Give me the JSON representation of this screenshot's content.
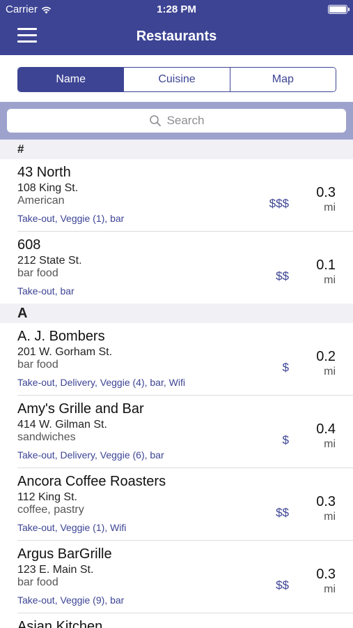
{
  "status_bar": {
    "carrier": "Carrier",
    "time": "1:28 PM"
  },
  "nav": {
    "title": "Restaurants"
  },
  "segments": [
    {
      "label": "Name",
      "active": true
    },
    {
      "label": "Cuisine",
      "active": false
    },
    {
      "label": "Map",
      "active": false
    }
  ],
  "search": {
    "placeholder": "Search"
  },
  "sections": [
    {
      "header": "#",
      "items": [
        {
          "name": "43 North",
          "address": "108 King St.",
          "cuisine": "American",
          "tags": "Take-out, Veggie (1), bar",
          "price": "$$$",
          "distance": "0.3",
          "unit": "mi"
        },
        {
          "name": "608",
          "address": "212 State St.",
          "cuisine": "bar food",
          "tags": "Take-out, bar",
          "price": "$$",
          "distance": "0.1",
          "unit": "mi"
        }
      ]
    },
    {
      "header": "A",
      "items": [
        {
          "name": "A. J. Bombers",
          "address": "201 W. Gorham St.",
          "cuisine": "bar food",
          "tags": "Take-out, Delivery, Veggie (4), bar, Wifi",
          "price": "$",
          "distance": "0.2",
          "unit": "mi"
        },
        {
          "name": "Amy's Grille and Bar",
          "address": "414 W. Gilman St.",
          "cuisine": "sandwiches",
          "tags": "Take-out, Delivery, Veggie (6), bar",
          "price": "$",
          "distance": "0.4",
          "unit": "mi"
        },
        {
          "name": "Ancora Coffee Roasters",
          "address": "112 King St.",
          "cuisine": "coffee, pastry",
          "tags": "Take-out, Veggie (1), Wifi",
          "price": "$$",
          "distance": "0.3",
          "unit": "mi"
        },
        {
          "name": "Argus BarGrille",
          "address": "123 E. Main St.",
          "cuisine": "bar food",
          "tags": "Take-out, Veggie (9), bar",
          "price": "$$",
          "distance": "0.3",
          "unit": "mi"
        },
        {
          "name": "Asian Kitchen",
          "address": "",
          "cuisine": "",
          "tags": "",
          "price": "",
          "distance": "",
          "unit": ""
        }
      ]
    }
  ],
  "colors": {
    "brand": "#3d4494",
    "search_band": "#9da2cd",
    "section_bg": "#f0f0f5"
  }
}
